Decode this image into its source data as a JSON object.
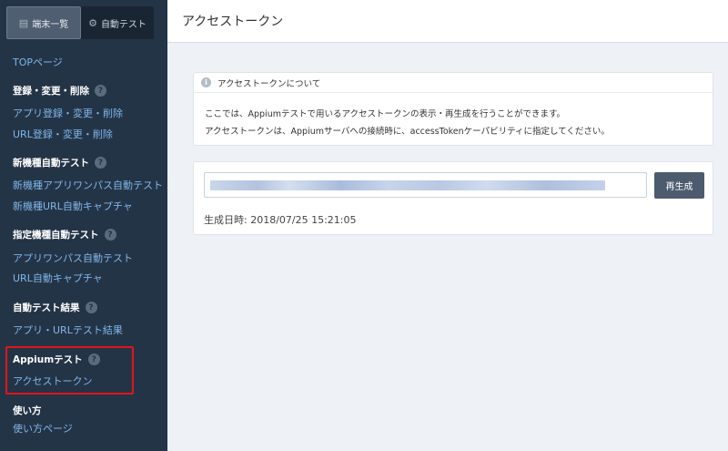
{
  "sidebar": {
    "tabs": [
      {
        "label": "端末一覧",
        "icon": "list-icon"
      },
      {
        "label": "自動テスト",
        "icon": "gears-icon"
      }
    ],
    "top_link": "TOPページ",
    "sections": [
      {
        "heading": "登録・変更・削除",
        "links": [
          "アプリ登録・変更・削除",
          "URL登録・変更・削除"
        ]
      },
      {
        "heading": "新機種自動テスト",
        "links": [
          "新機種アプリワンパス自動テスト",
          "新機種URL自動キャプチャ"
        ]
      },
      {
        "heading": "指定機種自動テスト",
        "links": [
          "アプリワンパス自動テスト",
          "URL自動キャプチャ"
        ]
      },
      {
        "heading": "自動テスト結果",
        "links": [
          "アプリ・URLテスト結果"
        ]
      },
      {
        "heading": "Appiumテスト",
        "links": [
          "アクセストークン"
        ]
      },
      {
        "heading": "使い方",
        "links": [
          "使い方ページ"
        ]
      }
    ],
    "help_glyph": "?"
  },
  "main": {
    "title": "アクセストークン",
    "info": {
      "heading": "アクセストークンについて",
      "icon_glyph": "i",
      "lines": [
        "ここでは、Appiumテストで用いるアクセストークンの表示・再生成を行うことができます。",
        "アクセストークンは、Appiumサーバへの接続時に、accessTokenケーパビリティに指定してください。"
      ]
    },
    "token": {
      "regenerate_label": "再生成",
      "created_label": "生成日時: 2018/07/25 15:21:05"
    }
  },
  "colors": {
    "sidebar_bg": "#243447",
    "link": "#7fb6e8",
    "highlight": "#e2141b",
    "button": "#4c5b6d"
  }
}
